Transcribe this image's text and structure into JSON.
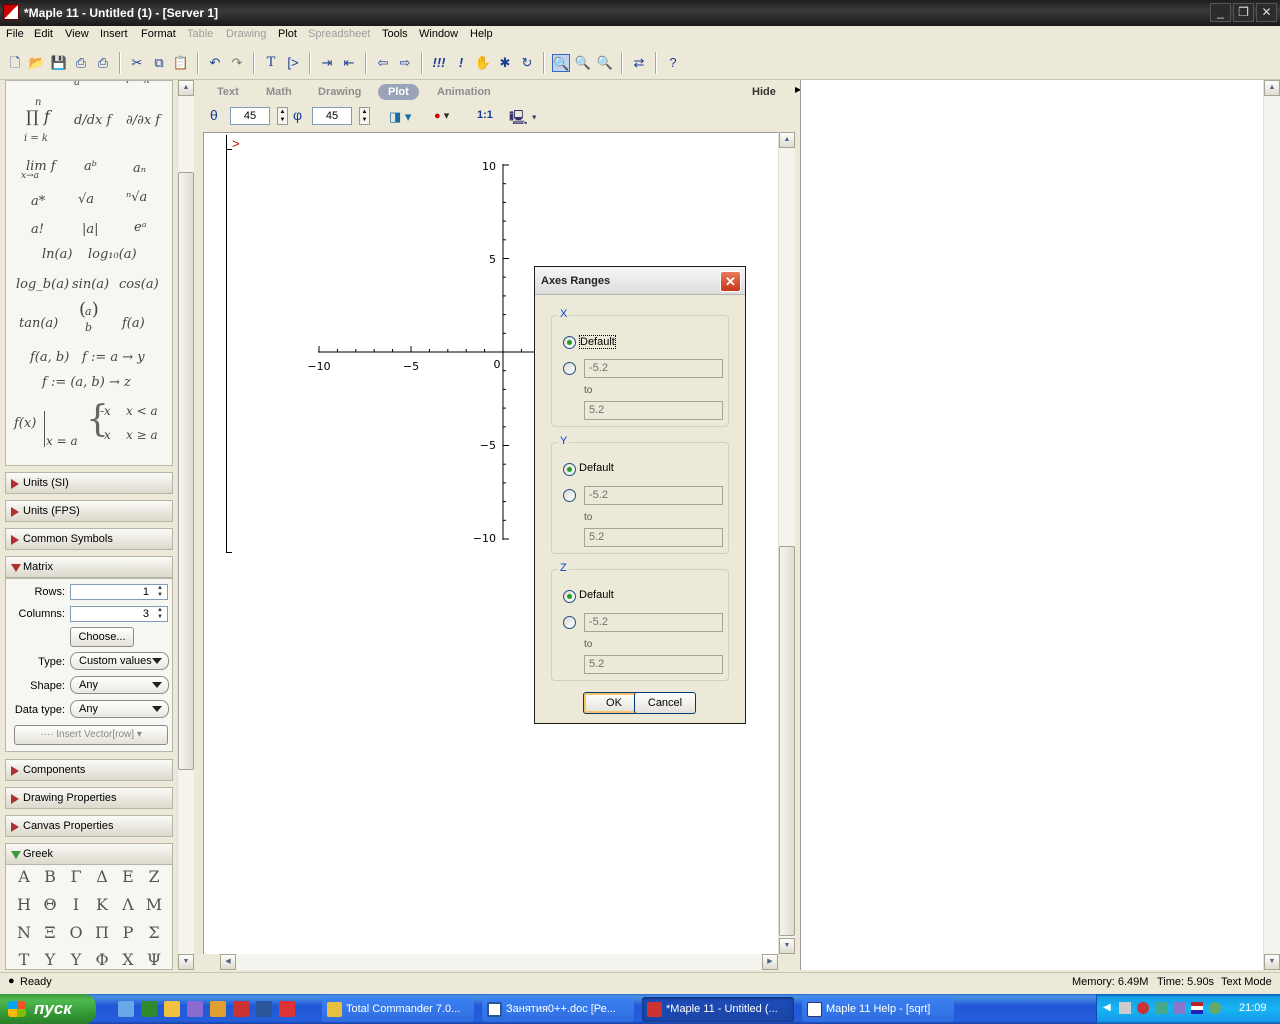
{
  "window": {
    "title": "*Maple 11 - Untitled (1) - [Server 1]",
    "minimize": "_",
    "maximize": "❐",
    "close": "✕"
  },
  "menu": [
    {
      "label": "File",
      "enabled": true
    },
    {
      "label": "Edit",
      "enabled": true
    },
    {
      "label": "View",
      "enabled": true
    },
    {
      "label": "Insert",
      "enabled": true
    },
    {
      "label": "Format",
      "enabled": true
    },
    {
      "label": "Table",
      "enabled": false
    },
    {
      "label": "Drawing",
      "enabled": false
    },
    {
      "label": "Plot",
      "enabled": true
    },
    {
      "label": "Spreadsheet",
      "enabled": false
    },
    {
      "label": "Tools",
      "enabled": true
    },
    {
      "label": "Window",
      "enabled": true
    },
    {
      "label": "Help",
      "enabled": true
    }
  ],
  "toolbar_icons": [
    "new-icon",
    "open-icon",
    "save-icon",
    "print-icon",
    "print-preview-icon",
    "cut-icon",
    "copy-icon",
    "paste-icon",
    "undo-icon",
    "redo-icon",
    "text-mode-icon",
    "math-prompt-icon",
    "indent-icon",
    "outdent-icon",
    "back-icon",
    "forward-icon",
    "execute-all-icon",
    "execute-icon",
    "stop-icon",
    "debug-icon",
    "restart-icon",
    "zoom-100-icon",
    "zoom-150-icon",
    "zoom-200-icon",
    "refresh-icon",
    "help-icon"
  ],
  "palette": {
    "expressions": {
      "prod": "∏ f",
      "prod_top": "n",
      "prod_bottom": "i = k",
      "deriv": "d/dx f",
      "partial": "∂/∂x f",
      "limit": "lim f",
      "limit_sub": "x→a",
      "power": "aᵇ",
      "subscript": "aₙ",
      "a_star": "a*",
      "sqrt": "√a",
      "nroot": "ⁿ√a",
      "factorial": "a!",
      "abs": "|a|",
      "exp": "eᵃ",
      "ln": "ln(a)",
      "log10": "log₁₀(a)",
      "logb": "log_b(a)",
      "sin": "sin(a)",
      "cos": "cos(a)",
      "tan": "tan(a)",
      "binom_top": "a",
      "binom_bottom": "b",
      "func": "f(a)",
      "fab": "f(a, b)",
      "arrow1": "f := a → y",
      "arrow2": "f := (a, b) → z",
      "eval": "f(x)",
      "eval_at": "x = a",
      "pw1_expr": "-x",
      "pw1_cond": "x < a",
      "pw2_expr": "x",
      "pw2_cond": "x ≥ a"
    },
    "sections": {
      "units_si": "Units (SI)",
      "units_fps": "Units (FPS)",
      "common_symbols": "Common Symbols",
      "matrix": "Matrix",
      "components": "Components",
      "drawing_properties": "Drawing Properties",
      "canvas_properties": "Canvas Properties",
      "greek": "Greek"
    },
    "matrix": {
      "rows_label": "Rows:",
      "rows_value": "1",
      "columns_label": "Columns:",
      "columns_value": "3",
      "choose_label": "Choose...",
      "type_label": "Type:",
      "type_value": "Custom values",
      "shape_label": "Shape:",
      "shape_value": "Any",
      "datatype_label": "Data type:",
      "datatype_value": "Any",
      "insert_label": "···· Insert Vector[row]"
    },
    "greek_letters": [
      "Α",
      "Β",
      "Γ",
      "Δ",
      "Ε",
      "Ζ",
      "Η",
      "Θ",
      "Ι",
      "Κ",
      "Λ",
      "Μ",
      "Ν",
      "Ξ",
      "Ο",
      "Π",
      "Ρ",
      "Σ",
      "Τ",
      "Υ",
      "Υ",
      "Φ",
      "Χ",
      "Ψ"
    ]
  },
  "context_bar": {
    "tabs": [
      {
        "label": "Text",
        "active": false
      },
      {
        "label": "Math",
        "active": false
      },
      {
        "label": "Drawing",
        "active": false
      },
      {
        "label": "Plot",
        "active": true
      },
      {
        "label": "Animation",
        "active": false
      }
    ],
    "hide_label": "Hide",
    "theta_symbol": "θ",
    "theta_value": "45",
    "phi_symbol": "φ",
    "phi_value": "45",
    "scale_label": "1:1"
  },
  "document": {
    "prompt": ">"
  },
  "plot": {
    "y_ticks": [
      "10",
      "5",
      "−5",
      "−10"
    ],
    "x_ticks": [
      "−10",
      "−5",
      "0"
    ]
  },
  "dialog": {
    "title": "Axes Ranges",
    "close": "✕",
    "groups": [
      {
        "label": "X",
        "default_label": "Default",
        "from_value": "-5.2",
        "to_label": "to",
        "to_value": "5.2"
      },
      {
        "label": "Y",
        "default_label": "Default",
        "from_value": "-5.2",
        "to_label": "to",
        "to_value": "5.2"
      },
      {
        "label": "Z",
        "default_label": "Default",
        "from_value": "-5.2",
        "to_label": "to",
        "to_value": "5.2"
      }
    ],
    "ok_label": "OK",
    "cancel_label": "Cancel"
  },
  "status": {
    "state": "Ready",
    "memory": "Memory: 6.49M",
    "time": "Time: 5.90s",
    "mode": "Text Mode"
  },
  "taskbar": {
    "start_label": "пуск",
    "tasks": [
      {
        "label": "Total Commander 7.0...",
        "active": false
      },
      {
        "label": "Занятия0++.doc [Ре...",
        "active": false
      },
      {
        "label": "*Maple 11 - Untitled (...",
        "active": true
      },
      {
        "label": "Maple 11 Help - [sqrt]",
        "active": false
      }
    ],
    "clock": "21:09"
  },
  "colors": {
    "accent_red": "#b03030",
    "selection_blue": "#316ac5",
    "taskbar_blue": "#245edb",
    "dialog_group_label": "#0046d5"
  }
}
